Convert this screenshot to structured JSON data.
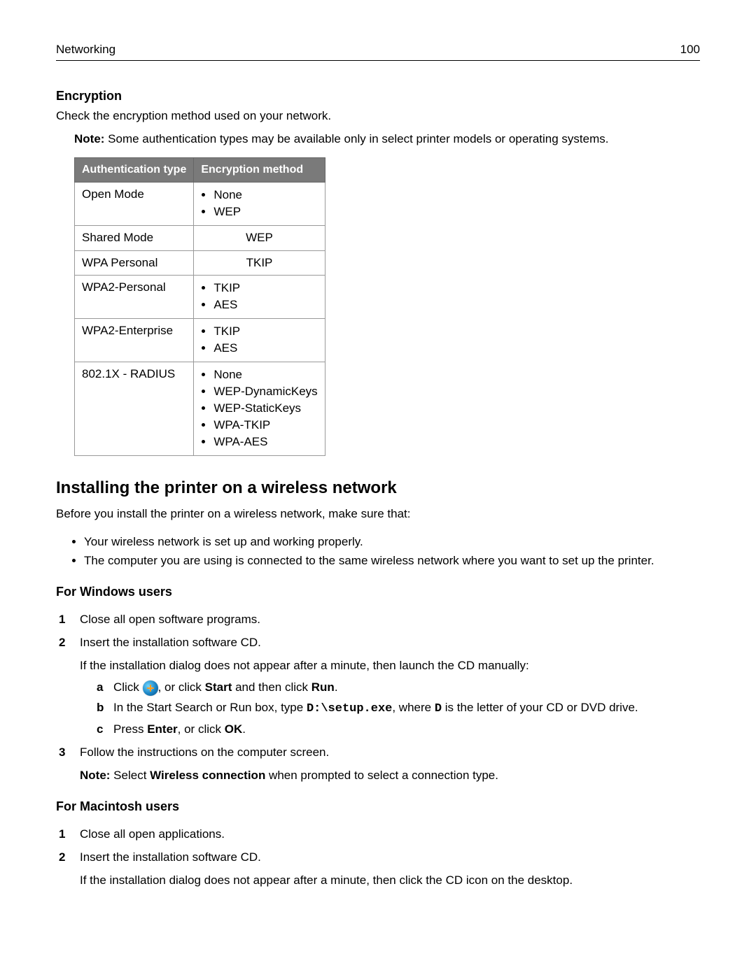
{
  "header": {
    "section": "Networking",
    "page": "100"
  },
  "encryption": {
    "title": "Encryption",
    "intro": "Check the encryption method used on your network.",
    "note_label": "Note:",
    "note_text": " Some authentication types may be available only in select printer models or operating systems.",
    "col1": "Authentication type",
    "col2": "Encryption method",
    "rows": {
      "r0": {
        "type": "Open Mode",
        "methods": [
          "None",
          "WEP"
        ]
      },
      "r1": {
        "type": "Shared Mode",
        "method_single": "WEP"
      },
      "r2": {
        "type": "WPA Personal",
        "method_single": "TKIP"
      },
      "r3": {
        "type": "WPA2-Personal",
        "methods": [
          "TKIP",
          "AES"
        ]
      },
      "r4": {
        "type": "WPA2-Enterprise",
        "methods": [
          "TKIP",
          "AES"
        ]
      },
      "r5": {
        "type": "802.1X - RADIUS",
        "methods": [
          "None",
          "WEP-DynamicKeys",
          "WEP-StaticKeys",
          "WPA-TKIP",
          "WPA-AES"
        ]
      }
    }
  },
  "install": {
    "title": "Installing the printer on a wireless network",
    "intro": "Before you install the printer on a wireless network, make sure that:",
    "bullets": {
      "b0": "Your wireless network is set up and working properly.",
      "b1": "The computer you are using is connected to the same wireless network where you want to set up the printer."
    }
  },
  "windows": {
    "title": "For Windows users",
    "s1": "Close all open software programs.",
    "s2": "Insert the installation software CD.",
    "s2b": "If the installation dialog does not appear after a minute, then launch the CD manually:",
    "a_pre": "Click ",
    "a_mid": ", or click ",
    "a_start": "Start",
    "a_mid2": " and then click ",
    "a_run": "Run",
    "a_post": ".",
    "b_pre": "In the Start Search or Run box, type ",
    "b_cmd": "D:\\setup.exe",
    "b_mid": ", where ",
    "b_d": "D",
    "b_post": " is the letter of your CD or DVD drive.",
    "c_pre": "Press ",
    "c_enter": "Enter",
    "c_mid": ", or click ",
    "c_ok": "OK",
    "c_post": ".",
    "s3": "Follow the instructions on the computer screen.",
    "note_label": "Note:",
    "note_pre": " Select ",
    "note_bold": "Wireless connection",
    "note_post": " when prompted to select a connection type."
  },
  "mac": {
    "title": "For Macintosh users",
    "s1": "Close all open applications.",
    "s2": "Insert the installation software CD.",
    "s2b": "If the installation dialog does not appear after a minute, then click the CD icon on the desktop."
  }
}
